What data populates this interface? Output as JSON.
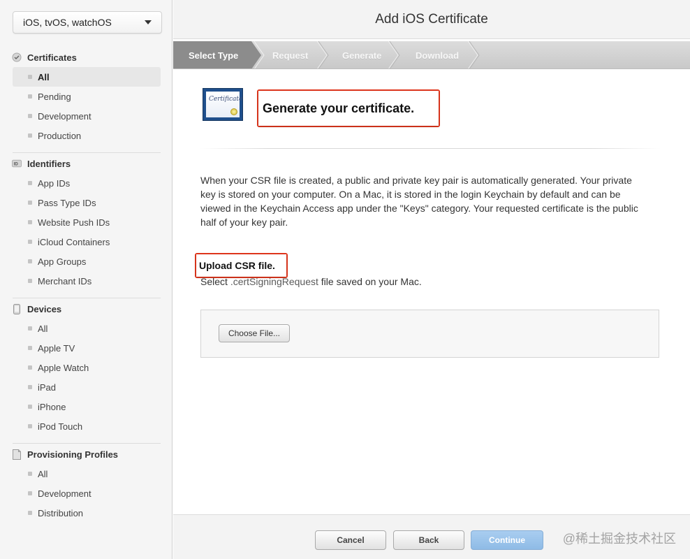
{
  "sidebar": {
    "platform_selected": "iOS, tvOS, watchOS",
    "sections": {
      "certificates": {
        "label": "Certificates",
        "icon": "certificate-seal-icon",
        "items": [
          "All",
          "Pending",
          "Development",
          "Production"
        ],
        "active": "All"
      },
      "identifiers": {
        "label": "Identifiers",
        "icon": "id-badge-icon",
        "items": [
          "App IDs",
          "Pass Type IDs",
          "Website Push IDs",
          "iCloud Containers",
          "App Groups",
          "Merchant IDs"
        ]
      },
      "devices": {
        "label": "Devices",
        "icon": "device-icon",
        "items": [
          "All",
          "Apple TV",
          "Apple Watch",
          "iPad",
          "iPhone",
          "iPod Touch"
        ]
      },
      "profiles": {
        "label": "Provisioning Profiles",
        "icon": "document-icon",
        "items": [
          "All",
          "Development",
          "Distribution"
        ]
      }
    }
  },
  "main": {
    "title": "Add iOS Certificate",
    "steps": [
      "Select Type",
      "Request",
      "Generate",
      "Download"
    ],
    "active_step": "Select Type",
    "cert_icon_text": "Certificate",
    "heading": "Generate your certificate.",
    "description": "When your CSR file is created, a public and private key pair is automatically generated. Your private key is stored on your computer. On a Mac, it is stored in the login Keychain by default and can be viewed in the Keychain Access app under the \"Keys\" category. Your requested certificate is the public half of your key pair.",
    "upload_title": "Upload CSR file.",
    "upload_sub_prefix": "Select ",
    "upload_sub_ext": ".certSigningRequest",
    "upload_sub_suffix": " file saved on your Mac.",
    "choose_file_label": "Choose File..."
  },
  "footer": {
    "cancel_label": "Cancel",
    "back_label": "Back",
    "continue_label": "Continue"
  },
  "watermark": "@稀土掘金技术社区",
  "colors": {
    "highlight": "#e2371d",
    "continue_button": "#9fc6ee",
    "active_step": "#8c8c8c"
  }
}
